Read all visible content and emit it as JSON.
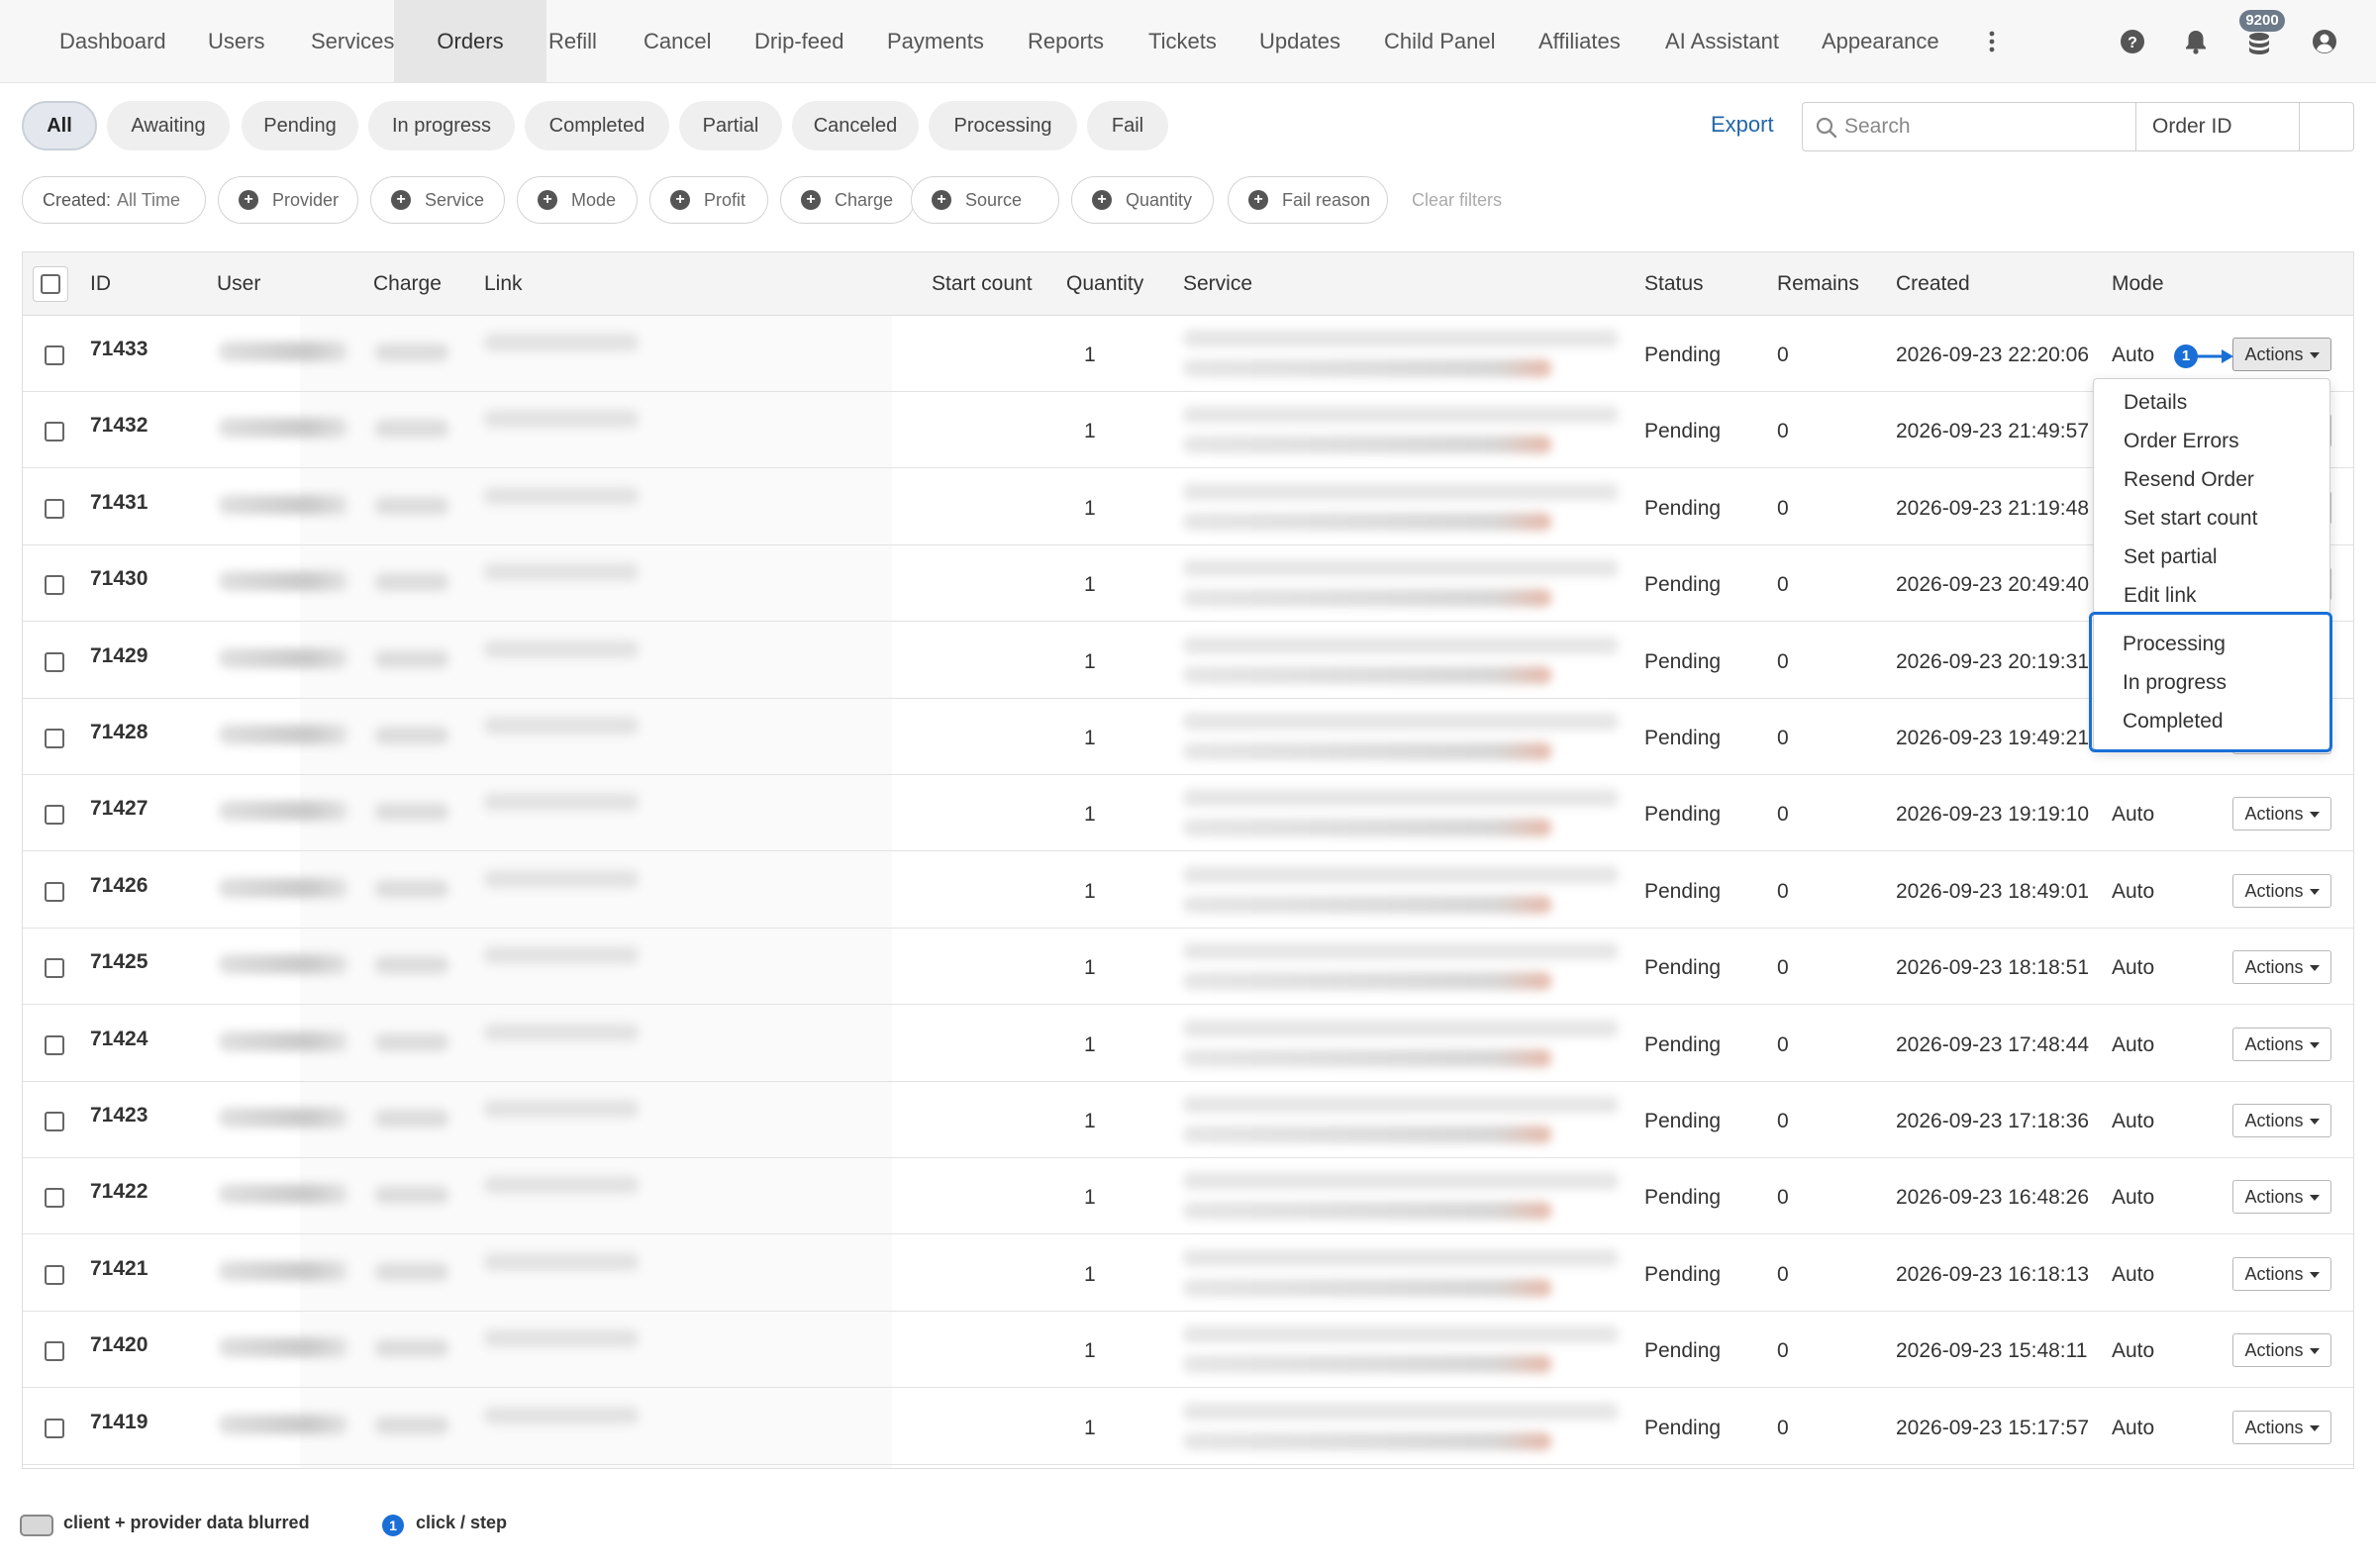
{
  "nav": {
    "items": [
      "Dashboard",
      "Users",
      "Services",
      "Orders",
      "Refill",
      "Cancel",
      "Drip-feed",
      "Payments",
      "Reports",
      "Tickets",
      "Updates",
      "Child Panel",
      "Affiliates",
      "AI Assistant",
      "Appearance"
    ],
    "active": "Orders",
    "balance_badge": "9200",
    "icons": [
      "more-vertical-icon",
      "help-icon",
      "bell-icon",
      "coins-icon",
      "account-icon"
    ]
  },
  "status_tabs": [
    "All",
    "Awaiting",
    "Pending",
    "In progress",
    "Completed",
    "Partial",
    "Canceled",
    "Processing",
    "Fail"
  ],
  "status_active": "All",
  "toolbar": {
    "export_label": "Export",
    "search_placeholder": "Search",
    "search_field_select": "Order ID"
  },
  "filters": {
    "created_label": "Created:",
    "created_value": "All Time",
    "chips": [
      "Provider",
      "Service",
      "Mode",
      "Profit",
      "Charge",
      "Source",
      "Quantity",
      "Fail reason"
    ],
    "clear_label": "Clear filters"
  },
  "table": {
    "headers": [
      "ID",
      "User",
      "Charge",
      "Link",
      "Start count",
      "Quantity",
      "Service",
      "Status",
      "Remains",
      "Created",
      "Mode"
    ],
    "rows": [
      {
        "id": "71433",
        "quantity": "1",
        "status": "Pending",
        "remains": "0",
        "created": "2026-09-23 22:20:06",
        "mode": "Auto"
      },
      {
        "id": "71432",
        "quantity": "1",
        "status": "Pending",
        "remains": "0",
        "created": "2026-09-23 21:49:57",
        "mode": ""
      },
      {
        "id": "71431",
        "quantity": "1",
        "status": "Pending",
        "remains": "0",
        "created": "2026-09-23 21:19:48",
        "mode": ""
      },
      {
        "id": "71430",
        "quantity": "1",
        "status": "Pending",
        "remains": "0",
        "created": "2026-09-23 20:49:40",
        "mode": ""
      },
      {
        "id": "71429",
        "quantity": "1",
        "status": "Pending",
        "remains": "0",
        "created": "2026-09-23 20:19:31",
        "mode": ""
      },
      {
        "id": "71428",
        "quantity": "1",
        "status": "Pending",
        "remains": "0",
        "created": "2026-09-23 19:49:21",
        "mode": ""
      },
      {
        "id": "71427",
        "quantity": "1",
        "status": "Pending",
        "remains": "0",
        "created": "2026-09-23 19:19:10",
        "mode": "Auto"
      },
      {
        "id": "71426",
        "quantity": "1",
        "status": "Pending",
        "remains": "0",
        "created": "2026-09-23 18:49:01",
        "mode": "Auto"
      },
      {
        "id": "71425",
        "quantity": "1",
        "status": "Pending",
        "remains": "0",
        "created": "2026-09-23 18:18:51",
        "mode": "Auto"
      },
      {
        "id": "71424",
        "quantity": "1",
        "status": "Pending",
        "remains": "0",
        "created": "2026-09-23 17:48:44",
        "mode": "Auto"
      },
      {
        "id": "71423",
        "quantity": "1",
        "status": "Pending",
        "remains": "0",
        "created": "2026-09-23 17:18:36",
        "mode": "Auto"
      },
      {
        "id": "71422",
        "quantity": "1",
        "status": "Pending",
        "remains": "0",
        "created": "2026-09-23 16:48:26",
        "mode": "Auto"
      },
      {
        "id": "71421",
        "quantity": "1",
        "status": "Pending",
        "remains": "0",
        "created": "2026-09-23 16:18:13",
        "mode": "Auto"
      },
      {
        "id": "71420",
        "quantity": "1",
        "status": "Pending",
        "remains": "0",
        "created": "2026-09-23 15:48:11",
        "mode": "Auto"
      },
      {
        "id": "71419",
        "quantity": "1",
        "status": "Pending",
        "remains": "0",
        "created": "2026-09-23 15:17:57",
        "mode": "Auto"
      }
    ],
    "actions_label": "Actions"
  },
  "actions_menu": {
    "items": [
      "Details",
      "Order Errors",
      "Resend Order",
      "Set start count",
      "Set partial",
      "Edit link"
    ],
    "status_items": [
      "Processing",
      "In progress",
      "Completed"
    ]
  },
  "annotation": {
    "step_number": "1",
    "legend_blur": "client + provider data blurred",
    "legend_step": "click / step"
  },
  "colors": {
    "accent": "#1a6fd6",
    "link": "#2266aa",
    "nav_bg": "#f7f7f7"
  }
}
